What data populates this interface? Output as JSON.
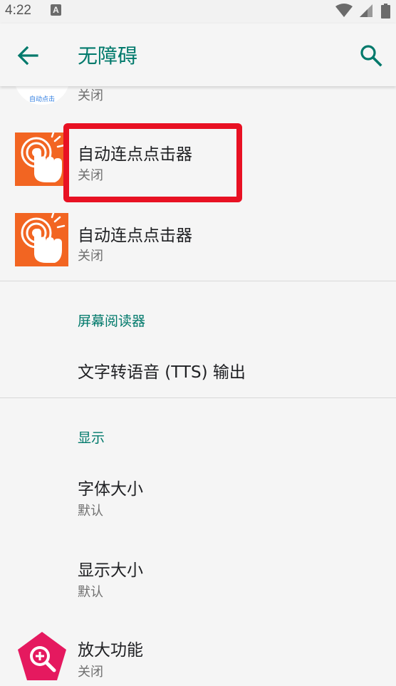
{
  "status_bar": {
    "time": "4:22",
    "notification_icon": "A"
  },
  "app_bar": {
    "title": "无障碍",
    "back_icon": "arrow-back-icon",
    "search_icon": "search-icon"
  },
  "partial_item": {
    "icon_label": "自动点击",
    "status": "关闭"
  },
  "items": [
    {
      "title": "自动连点点击器",
      "status": "关闭",
      "highlighted": true
    },
    {
      "title": "自动连点点击器",
      "status": "关闭",
      "highlighted": false
    }
  ],
  "screen_reader_section": {
    "header": "屏幕阅读器",
    "tts_label": "文字转语音 (TTS) 输出"
  },
  "display_section": {
    "header": "显示",
    "font_size": {
      "title": "字体大小",
      "value": "默认"
    },
    "display_size": {
      "title": "显示大小",
      "value": "默认"
    },
    "magnification": {
      "title": "放大功能",
      "status": "关闭"
    }
  },
  "colors": {
    "accent": "#00796b",
    "highlight": "#e81123",
    "icon_orange": "#f26522",
    "magnify_pink": "#e5195f"
  }
}
